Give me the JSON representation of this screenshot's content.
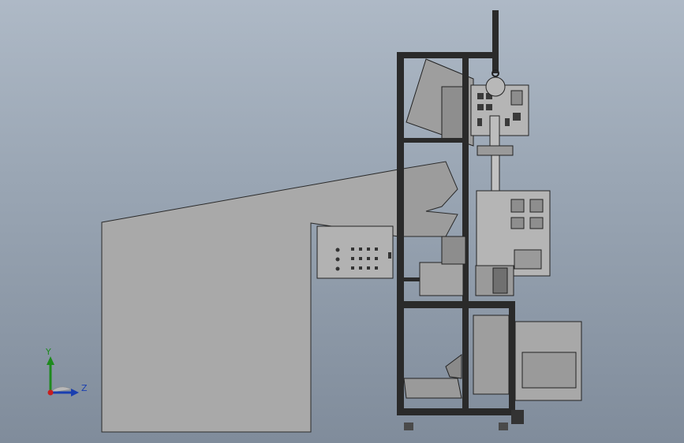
{
  "viewport": {
    "background_top": "#aeb9c6",
    "background_bottom": "#808c9b"
  },
  "triad": {
    "y_label": "Y",
    "z_label": "Z",
    "y_color": "#1e8a1e",
    "z_color": "#1a3fb0",
    "x_color": "#c81e1e"
  },
  "model": {
    "shade_color": "#a6a6a6",
    "edge_color": "#1a1a1a",
    "frame_color": "#262626"
  }
}
